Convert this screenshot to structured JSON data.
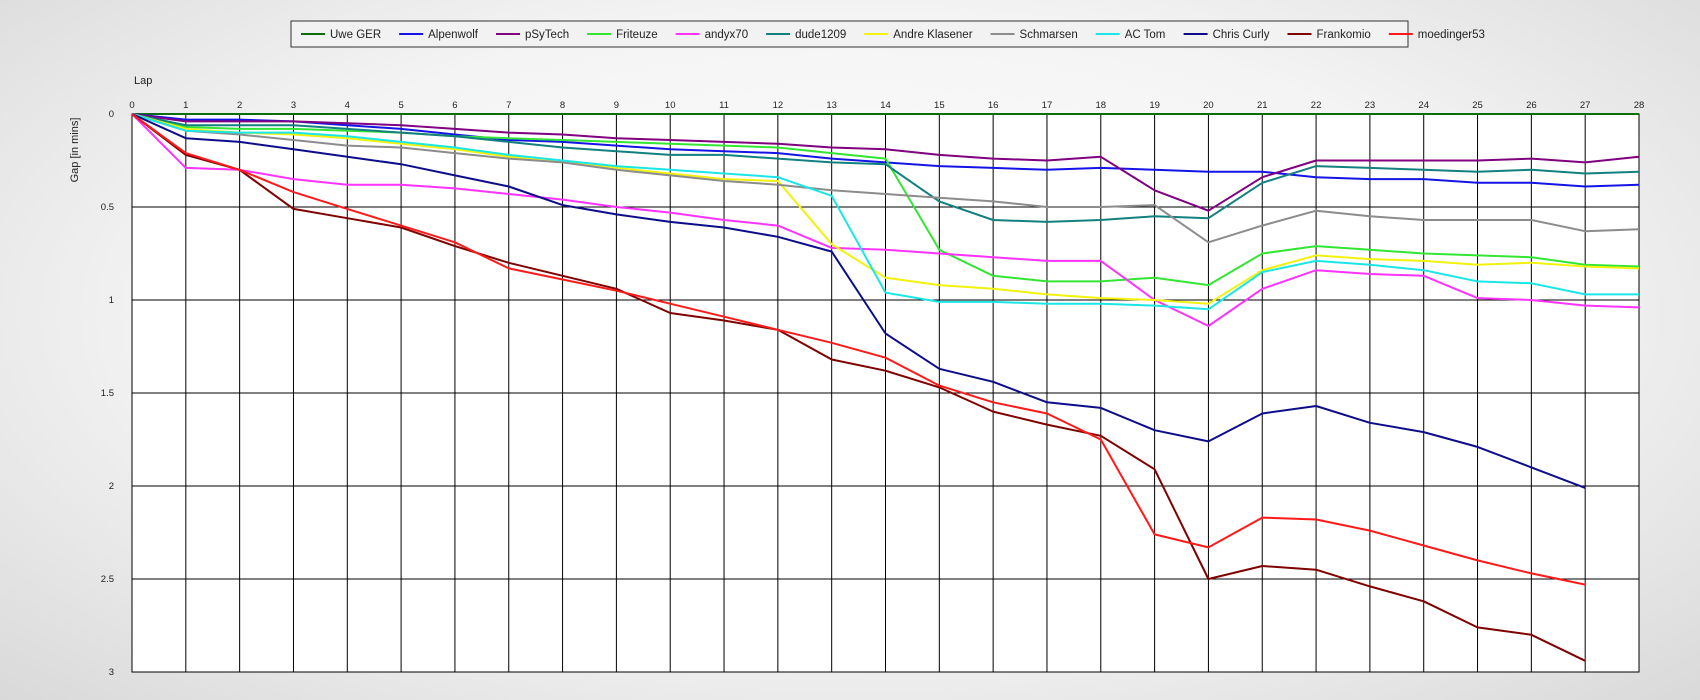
{
  "chart_data": {
    "type": "line",
    "xlabel": "Lap",
    "ylabel": "Gap [in mins]",
    "xlim": [
      0,
      28
    ],
    "ylim": [
      0,
      3
    ],
    "y_inverted": true,
    "grid": true,
    "legend_position": "top",
    "x_ticks": [
      "0",
      "1",
      "2",
      "3",
      "4",
      "5",
      "6",
      "7",
      "8",
      "9",
      "10",
      "11",
      "12",
      "13",
      "14",
      "15",
      "16",
      "17",
      "18",
      "19",
      "20",
      "21",
      "22",
      "23",
      "24",
      "25",
      "26",
      "27",
      "28"
    ],
    "y_ticks": [
      "0",
      "0.5",
      "1",
      "1.5",
      "2",
      "2.5",
      "3"
    ],
    "series": [
      {
        "name": "Uwe GER",
        "color": "#0a6e0a",
        "x": [
          0,
          1,
          2,
          3,
          4,
          5,
          6,
          7,
          8,
          9,
          10,
          11,
          12,
          13,
          14,
          15,
          16,
          17,
          18,
          19,
          20,
          21,
          22,
          23,
          24,
          25,
          26,
          27,
          28
        ],
        "y": [
          0,
          0,
          0,
          0,
          0,
          0,
          0,
          0,
          0,
          0,
          0,
          0,
          0,
          0,
          0,
          0,
          0,
          0,
          0,
          0,
          0,
          0,
          0,
          0,
          0,
          0,
          0,
          0,
          0
        ]
      },
      {
        "name": "Alpenwolf",
        "color": "#1414e6",
        "x": [
          0,
          1,
          2,
          3,
          4,
          5,
          6,
          7,
          8,
          9,
          10,
          11,
          12,
          13,
          14,
          15,
          16,
          17,
          18,
          19,
          20,
          21,
          22,
          23,
          24,
          25,
          26,
          27,
          28
        ],
        "y": [
          0,
          0.03,
          0.03,
          0.04,
          0.06,
          0.08,
          0.11,
          0.14,
          0.15,
          0.17,
          0.19,
          0.2,
          0.21,
          0.24,
          0.26,
          0.28,
          0.29,
          0.3,
          0.29,
          0.3,
          0.31,
          0.31,
          0.34,
          0.35,
          0.35,
          0.37,
          0.37,
          0.39,
          0.38
        ]
      },
      {
        "name": "pSyTech",
        "color": "#800080",
        "x": [
          0,
          1,
          2,
          3,
          4,
          5,
          6,
          7,
          8,
          9,
          10,
          11,
          12,
          13,
          14,
          15,
          16,
          17,
          18,
          19,
          20,
          21,
          22,
          23,
          24,
          25,
          26,
          27,
          28
        ],
        "y": [
          0,
          0.04,
          0.04,
          0.04,
          0.05,
          0.06,
          0.08,
          0.1,
          0.11,
          0.13,
          0.14,
          0.15,
          0.16,
          0.18,
          0.19,
          0.22,
          0.24,
          0.25,
          0.23,
          0.41,
          0.52,
          0.34,
          0.25,
          0.25,
          0.25,
          0.25,
          0.24,
          0.26,
          0.23
        ]
      },
      {
        "name": "Friteuze",
        "color": "#33e633",
        "x": [
          0,
          1,
          2,
          3,
          4,
          5,
          6,
          7,
          8,
          9,
          10,
          11,
          12,
          13,
          14,
          15,
          16,
          17,
          18,
          19,
          20,
          21,
          22,
          23,
          24,
          25,
          26,
          27,
          28
        ],
        "y": [
          0,
          0.07,
          0.08,
          0.08,
          0.09,
          0.1,
          0.12,
          0.13,
          0.14,
          0.15,
          0.16,
          0.17,
          0.18,
          0.21,
          0.24,
          0.73,
          0.87,
          0.9,
          0.9,
          0.88,
          0.92,
          0.75,
          0.71,
          0.73,
          0.75,
          0.76,
          0.77,
          0.81,
          0.82
        ]
      },
      {
        "name": "andyx70",
        "color": "#ff33ff",
        "x": [
          0,
          1,
          2,
          3,
          4,
          5,
          6,
          7,
          8,
          9,
          10,
          11,
          12,
          13,
          14,
          15,
          16,
          17,
          18,
          19,
          20,
          21,
          22,
          23,
          24,
          25,
          26,
          27,
          28
        ],
        "y": [
          0,
          0.29,
          0.3,
          0.35,
          0.38,
          0.38,
          0.4,
          0.43,
          0.46,
          0.5,
          0.53,
          0.57,
          0.6,
          0.72,
          0.73,
          0.75,
          0.77,
          0.79,
          0.79,
          1.0,
          1.14,
          0.94,
          0.84,
          0.86,
          0.87,
          0.99,
          1.0,
          1.03,
          1.04
        ]
      },
      {
        "name": "dude1209",
        "color": "#138080",
        "x": [
          0,
          1,
          2,
          3,
          4,
          5,
          6,
          7,
          8,
          9,
          10,
          11,
          12,
          13,
          14,
          15,
          16,
          17,
          18,
          19,
          20,
          21,
          22,
          23,
          24,
          25,
          26,
          27,
          28
        ],
        "y": [
          0,
          0.06,
          0.06,
          0.06,
          0.08,
          0.1,
          0.12,
          0.15,
          0.18,
          0.2,
          0.22,
          0.22,
          0.24,
          0.26,
          0.27,
          0.47,
          0.57,
          0.58,
          0.57,
          0.55,
          0.56,
          0.37,
          0.28,
          0.29,
          0.3,
          0.31,
          0.3,
          0.32,
          0.31
        ]
      },
      {
        "name": "Andre Klasener",
        "color": "#f2f20d",
        "x": [
          0,
          1,
          2,
          3,
          4,
          5,
          6,
          7,
          8,
          9,
          10,
          11,
          12,
          13,
          14,
          15,
          16,
          17,
          18,
          19,
          20,
          21,
          22,
          23,
          24,
          25,
          26,
          27,
          28
        ],
        "y": [
          0,
          0.08,
          0.1,
          0.11,
          0.13,
          0.16,
          0.19,
          0.23,
          0.26,
          0.29,
          0.32,
          0.35,
          0.36,
          0.7,
          0.88,
          0.92,
          0.94,
          0.97,
          0.99,
          1.0,
          1.02,
          0.84,
          0.76,
          0.78,
          0.79,
          0.81,
          0.8,
          0.82,
          0.83
        ]
      },
      {
        "name": "Schmarsen",
        "color": "#8c8c8c",
        "x": [
          0,
          1,
          2,
          3,
          4,
          5,
          6,
          7,
          8,
          9,
          10,
          11,
          12,
          13,
          14,
          15,
          16,
          17,
          18,
          19,
          20,
          21,
          22,
          23,
          24,
          25,
          26,
          27,
          28
        ],
        "y": [
          0,
          0.09,
          0.11,
          0.14,
          0.17,
          0.18,
          0.21,
          0.24,
          0.26,
          0.3,
          0.33,
          0.36,
          0.38,
          0.41,
          0.43,
          0.45,
          0.47,
          0.5,
          0.5,
          0.49,
          0.69,
          0.6,
          0.52,
          0.55,
          0.57,
          0.57,
          0.57,
          0.63,
          0.62
        ]
      },
      {
        "name": "AC Tom",
        "color": "#1ae6e6",
        "x": [
          0,
          1,
          2,
          3,
          4,
          5,
          6,
          7,
          8,
          9,
          10,
          11,
          12,
          13,
          14,
          15,
          16,
          17,
          18,
          19,
          20,
          21,
          22,
          23,
          24,
          25,
          26,
          27,
          28
        ],
        "y": [
          0,
          0.09,
          0.1,
          0.1,
          0.12,
          0.15,
          0.18,
          0.22,
          0.25,
          0.28,
          0.3,
          0.32,
          0.34,
          0.44,
          0.96,
          1.01,
          1.01,
          1.02,
          1.02,
          1.03,
          1.05,
          0.85,
          0.79,
          0.81,
          0.84,
          0.9,
          0.91,
          0.97,
          0.97
        ]
      },
      {
        "name": "Chris Curly",
        "color": "#0d0d8c",
        "x": [
          0,
          1,
          2,
          3,
          4,
          5,
          6,
          7,
          8,
          9,
          10,
          11,
          12,
          13,
          14,
          15,
          16,
          17,
          18,
          19,
          20,
          21,
          22,
          23,
          24,
          25,
          26,
          27
        ],
        "y": [
          0,
          0.13,
          0.15,
          0.19,
          0.23,
          0.27,
          0.33,
          0.39,
          0.49,
          0.54,
          0.58,
          0.61,
          0.66,
          0.74,
          1.18,
          1.37,
          1.44,
          1.55,
          1.58,
          1.7,
          1.76,
          1.61,
          1.57,
          1.66,
          1.71,
          1.79,
          1.9,
          2.01
        ]
      },
      {
        "name": "Frankomio",
        "color": "#800000",
        "x": [
          0,
          1,
          2,
          3,
          4,
          5,
          6,
          7,
          8,
          9,
          10,
          11,
          12,
          13,
          14,
          15,
          16,
          17,
          18,
          19,
          20,
          21,
          22,
          23,
          24,
          25,
          26,
          27
        ],
        "y": [
          0,
          0.22,
          0.3,
          0.51,
          0.56,
          0.61,
          0.71,
          0.8,
          0.87,
          0.94,
          1.07,
          1.11,
          1.16,
          1.32,
          1.38,
          1.47,
          1.6,
          1.67,
          1.73,
          1.91,
          2.5,
          2.43,
          2.45,
          2.54,
          2.62,
          2.76,
          2.8,
          2.94
        ]
      },
      {
        "name": "moedinger53",
        "color": "#ff1a1a",
        "x": [
          0,
          1,
          2,
          3,
          4,
          5,
          6,
          7,
          8,
          9,
          10,
          11,
          12,
          13,
          14,
          15,
          16,
          17,
          18,
          19,
          20,
          21,
          22,
          23,
          24,
          25,
          26,
          27
        ],
        "y": [
          0,
          0.21,
          0.3,
          0.42,
          0.51,
          0.6,
          0.69,
          0.83,
          0.89,
          0.95,
          1.02,
          1.09,
          1.16,
          1.23,
          1.31,
          1.46,
          1.55,
          1.61,
          1.75,
          2.26,
          2.33,
          2.17,
          2.18,
          2.24,
          2.32,
          2.4,
          2.47,
          2.53
        ]
      }
    ]
  }
}
